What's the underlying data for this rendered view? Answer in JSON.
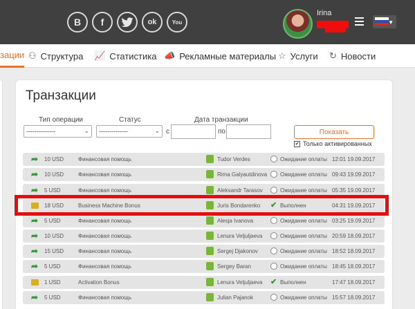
{
  "social": [
    {
      "icon": "vk-icon",
      "glyph": "B"
    },
    {
      "icon": "facebook-icon",
      "glyph": "f"
    },
    {
      "icon": "twitter-icon",
      "glyph": "🐦"
    },
    {
      "icon": "odnoklassniki-icon",
      "glyph": "ok"
    },
    {
      "icon": "youtube-icon",
      "glyph": "You"
    }
  ],
  "user": {
    "name": "Irina"
  },
  "nav": [
    {
      "label": "Транзакции",
      "icon": "transactions-icon",
      "active": true,
      "display": "зации"
    },
    {
      "label": "Структура",
      "icon": "structure-icon"
    },
    {
      "label": "Статистика",
      "icon": "statistics-icon"
    },
    {
      "label": "Рекламные материалы",
      "icon": "megaphone-icon"
    },
    {
      "label": "Услуги",
      "icon": "star-icon"
    },
    {
      "label": "Новости",
      "icon": "news-icon"
    }
  ],
  "page": {
    "title": "Транзакции"
  },
  "filters": {
    "operation_type": {
      "label": "Тип операции",
      "value": "--------------"
    },
    "status": {
      "label": "Статус",
      "value": "--------------"
    },
    "date": {
      "label": "Дата транзакции",
      "from_label": "с",
      "to_label": "по"
    },
    "show_button": "Показать",
    "only_active": "Только активированных"
  },
  "transactions": [
    {
      "type": "transfer",
      "amount": "10 USD",
      "description": "Финансовая помощь",
      "name": "Tudor Verdes",
      "status": "Ожидание оплаты",
      "status_type": "pending",
      "date": "12:01 19.09.2017"
    },
    {
      "type": "transfer",
      "amount": "10 USD",
      "description": "Финансовая помощь",
      "name": "Rima Galyautdinova",
      "status": "Ожидание оплаты",
      "status_type": "pending",
      "date": "09:43 19.09.2017"
    },
    {
      "type": "transfer",
      "amount": "5 USD",
      "description": "Финансовая помощь",
      "name": "Aleksandr Tarasov",
      "status": "Ожидание оплаты",
      "status_type": "pending",
      "date": "05:35 19.09.2017"
    },
    {
      "type": "bonus",
      "amount": "18 USD",
      "description": "Business Machine Bonus",
      "name": "Juris Bondarenko",
      "status": "Выполнен",
      "status_type": "done",
      "date": "04:31 19.09.2017"
    },
    {
      "type": "transfer",
      "amount": "5 USD",
      "description": "Финансовая помощь",
      "name": "Alesja Ivanova",
      "status": "Ожидание оплаты",
      "status_type": "pending",
      "date": "03:25 19.09.2017"
    },
    {
      "type": "transfer",
      "amount": "10 USD",
      "description": "Финансовая помощь",
      "name": "Lenura Veljuljaeva",
      "status": "Ожидание оплаты",
      "status_type": "pending",
      "date": "20:59 18.09.2017"
    },
    {
      "type": "transfer",
      "amount": "15 USD",
      "description": "Финансовая помощь",
      "name": "Sergej Djakonov",
      "status": "Ожидание оплаты",
      "status_type": "pending",
      "date": "18:52 18.09.2017"
    },
    {
      "type": "transfer",
      "amount": "5 USD",
      "description": "Финансовая помощь",
      "name": "Sergey Baran",
      "status": "Ожидание оплаты",
      "status_type": "pending",
      "date": "18:45 18.09.2017"
    },
    {
      "type": "bonus",
      "amount": "1 USD",
      "description": "Activation Bonus",
      "name": "Lenura Veljuljaeva",
      "status": "Выполнен",
      "status_type": "done",
      "date": "17:47 18.09.2017"
    },
    {
      "type": "transfer",
      "amount": "5 USD",
      "description": "Финансовая помощь",
      "name": "Julian Pajanok",
      "status": "Ожидание оплаты",
      "status_type": "pending",
      "date": "15:57 18.09.2017"
    }
  ],
  "colors": {
    "accent": "#e8702a",
    "highlight": "#e50d0d",
    "topbar": "#404040"
  }
}
